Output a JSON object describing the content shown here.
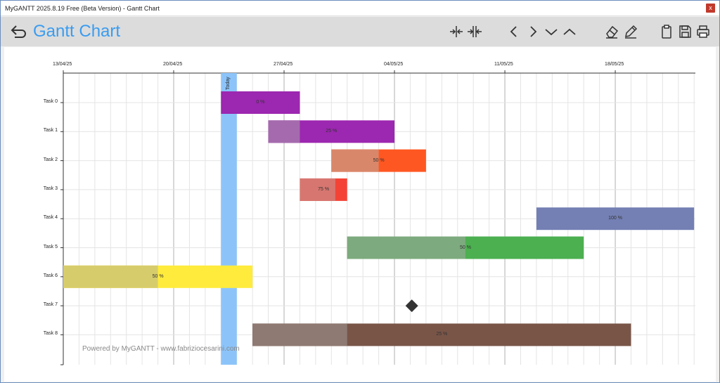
{
  "window": {
    "title": "MyGANTT 2025.8.19 Free (Beta Version) - Gantt Chart",
    "close_label": "x"
  },
  "toolbar": {
    "app_title": "Gantt Chart",
    "icons": [
      "back-arrow-icon",
      "expand-horizontal-icon",
      "collapse-horizontal-icon",
      "chevron-left-icon",
      "chevron-right-icon",
      "chevron-down-icon",
      "chevron-up-icon",
      "eraser-icon",
      "pencil-icon",
      "clipboard-icon",
      "save-icon",
      "print-icon"
    ]
  },
  "chart": {
    "today_label": "Today",
    "watermark": "Powered by MyGANTT - www.fabriziocesarini.com",
    "dates": [
      "13/04/25",
      "20/04/25",
      "27/04/25",
      "04/05/25",
      "11/05/25",
      "18/05/25"
    ],
    "tasks": [
      {
        "name": "Task 0",
        "progress_label": "0 %",
        "progress": 0,
        "color": "#9c27b0",
        "light": "#b26fbf"
      },
      {
        "name": "Task 1",
        "progress_label": "25 %",
        "progress": 25,
        "color": "#9c27b0",
        "light": "#a56aae"
      },
      {
        "name": "Task 2",
        "progress_label": "50 %",
        "progress": 50,
        "color": "#ff5722",
        "light": "#d9876a"
      },
      {
        "name": "Task 3",
        "progress_label": "75 %",
        "progress": 75,
        "color": "#f44336",
        "light": "#d77670"
      },
      {
        "name": "Task 4",
        "progress_label": "100 %",
        "progress": 100,
        "color": "#7480b4",
        "light": "#7480b4"
      },
      {
        "name": "Task 5",
        "progress_label": "50 %",
        "progress": 50,
        "color": "#4caf50",
        "light": "#7daa7e"
      },
      {
        "name": "Task 6",
        "progress_label": "50 %",
        "progress": 50,
        "color": "#ffeb3b",
        "light": "#d7cc6c"
      },
      {
        "name": "Task 7",
        "progress_label": "",
        "progress": 0,
        "color": "#333333",
        "light": "#333333"
      },
      {
        "name": "Task 8",
        "progress_label": "25 %",
        "progress": 25,
        "color": "#795548",
        "light": "#8e7a72"
      }
    ],
    "colors": {
      "today": "#8cc4fa",
      "grid": "#e4e4e4",
      "major_grid": "#b0b0b0"
    }
  }
}
